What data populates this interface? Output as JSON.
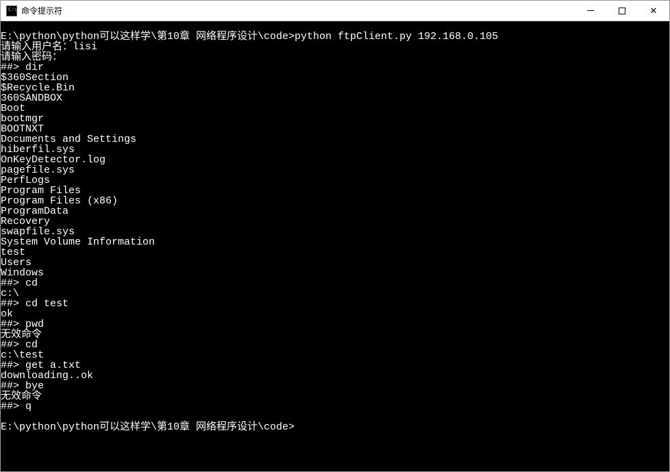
{
  "window": {
    "title": "命令提示符"
  },
  "terminal": {
    "lines": [
      "",
      "E:\\python\\python可以这样学\\第10章 网络程序设计\\code>python ftpClient.py 192.168.0.105",
      "请输入用户名：lisi",
      "请输入密码：",
      "##> dir",
      "$360Section",
      "$Recycle.Bin",
      "360SANDBOX",
      "Boot",
      "bootmgr",
      "BOOTNXT",
      "Documents and Settings",
      "hiberfil.sys",
      "OnKeyDetector.log",
      "pagefile.sys",
      "PerfLogs",
      "Program Files",
      "Program Files (x86)",
      "ProgramData",
      "Recovery",
      "swapfile.sys",
      "System Volume Information",
      "test",
      "Users",
      "Windows",
      "##> cd",
      "c:\\",
      "##> cd test",
      "ok",
      "##> pwd",
      "无效命令",
      "##> cd",
      "c:\\test",
      "##> get a.txt",
      "downloading..ok",
      "##> bye",
      "无效命令",
      "##> q",
      "",
      "E:\\python\\python可以这样学\\第10章 网络程序设计\\code>"
    ]
  }
}
